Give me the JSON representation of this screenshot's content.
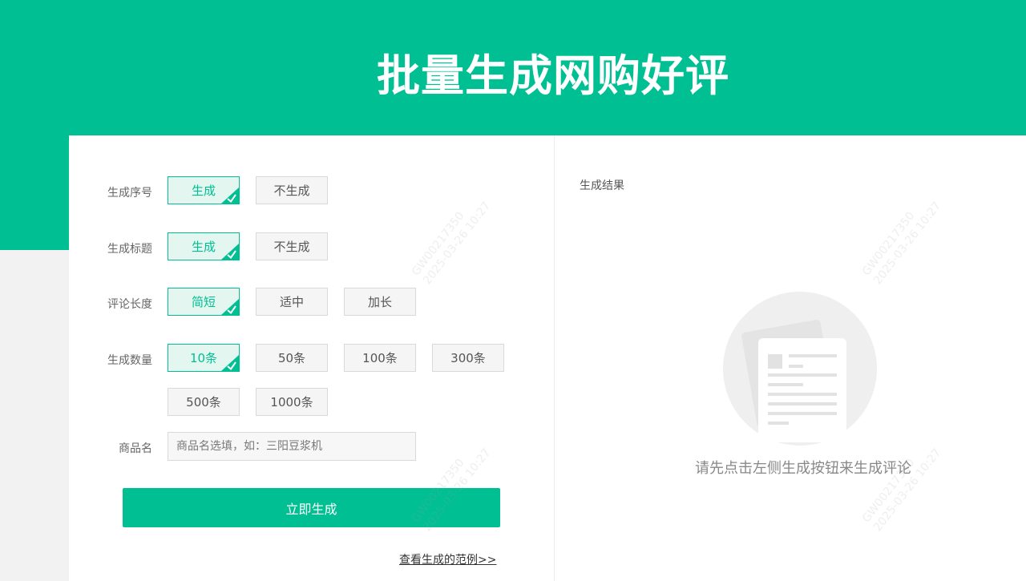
{
  "header": {
    "title": "批量生成网购好评"
  },
  "form": {
    "rows": [
      {
        "label": "生成序号",
        "options": [
          {
            "text": "生成",
            "selected": true
          },
          {
            "text": "不生成",
            "selected": false
          }
        ]
      },
      {
        "label": "生成标题",
        "options": [
          {
            "text": "生成",
            "selected": true
          },
          {
            "text": "不生成",
            "selected": false
          }
        ]
      },
      {
        "label": "评论长度",
        "options": [
          {
            "text": "简短",
            "selected": true
          },
          {
            "text": "适中",
            "selected": false
          },
          {
            "text": "加长",
            "selected": false
          }
        ]
      },
      {
        "label": "生成数量",
        "options": [
          {
            "text": "10条",
            "selected": true
          },
          {
            "text": "50条",
            "selected": false
          },
          {
            "text": "100条",
            "selected": false
          },
          {
            "text": "300条",
            "selected": false
          },
          {
            "text": "500条",
            "selected": false
          },
          {
            "text": "1000条",
            "selected": false
          }
        ]
      }
    ],
    "product": {
      "label": "商品名",
      "placeholder": "商品名选填，如：三阳豆浆机",
      "value": ""
    },
    "generate_label": "立即生成",
    "example_link": "查看生成的范例>>"
  },
  "result": {
    "title": "生成结果",
    "empty_hint": "请先点击左侧生成按钮来生成评论",
    "empty_icon": "document-placeholder-icon"
  },
  "watermark": {
    "id": "GW00217350",
    "date": "2025-03-26 10:27"
  },
  "colors": {
    "brand": "#00bf93",
    "selected_bg": "#e3f7f0",
    "option_bg": "#f5f5f5",
    "page_bg": "#f2f2f2"
  }
}
